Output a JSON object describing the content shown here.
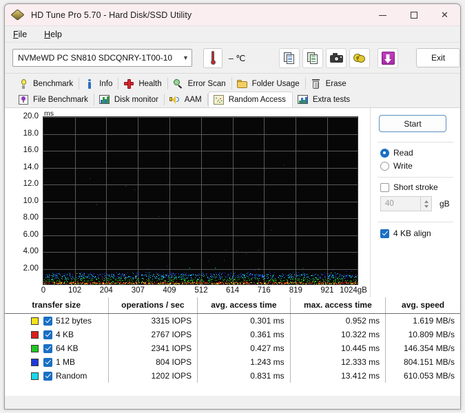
{
  "window": {
    "title": "HD Tune Pro 5.70 - Hard Disk/SSD Utility",
    "app_icon": "diamond-icon",
    "minimize_label": "—",
    "maximize_label": "□",
    "close_label": "✕"
  },
  "menu": {
    "items": [
      {
        "label": "File",
        "mnemonic": "F"
      },
      {
        "label": "Help",
        "mnemonic": "H"
      }
    ]
  },
  "toolbar": {
    "drive": "NVMeWD PC SN810 SDCQNRY-1T00-10",
    "drive_chevron": "▼",
    "temperature": "– ℃",
    "thermometer_icon": "thermometer-icon",
    "buttons": [
      {
        "name": "copy-to-clipboard-button",
        "icon": "copy-document-icon"
      },
      {
        "name": "export-button",
        "icon": "export-document-icon"
      },
      {
        "name": "screenshot-button",
        "icon": "camera-icon"
      },
      {
        "name": "measure-button",
        "icon": "tape-measure-icon"
      },
      {
        "name": "download-button",
        "icon": "download-arrow-icon"
      }
    ],
    "exit_label": "Exit"
  },
  "tabs": {
    "row1": [
      {
        "label": "Benchmark",
        "icon": "lightbulb-icon",
        "active": false
      },
      {
        "label": "Info",
        "icon": "info-icon",
        "active": false
      },
      {
        "label": "Health",
        "icon": "red-cross-icon",
        "active": false
      },
      {
        "label": "Error Scan",
        "icon": "magnifier-icon",
        "active": false
      },
      {
        "label": "Folder Usage",
        "icon": "folder-icon",
        "active": false
      },
      {
        "label": "Erase",
        "icon": "trash-icon",
        "active": false
      }
    ],
    "row2": [
      {
        "label": "File Benchmark",
        "icon": "file-benchmark-icon",
        "active": false
      },
      {
        "label": "Disk monitor",
        "icon": "bar-chart-icon",
        "active": false
      },
      {
        "label": "AAM",
        "icon": "speaker-icon",
        "active": false
      },
      {
        "label": "Random Access",
        "icon": "scatter-plot-icon",
        "active": true
      },
      {
        "label": "Extra tests",
        "icon": "extra-tests-icon",
        "active": false
      }
    ]
  },
  "panel": {
    "start_label": "Start",
    "read_label": "Read",
    "write_label": "Write",
    "read_selected": true,
    "write_selected": false,
    "short_stroke_label": "Short stroke",
    "short_stroke_checked": false,
    "short_stroke_value": "40",
    "short_stroke_unit": "gB",
    "align_label": "4 KB align",
    "align_checked": true
  },
  "chart_data": {
    "type": "scatter",
    "title": "",
    "xlabel": "",
    "ylabel": "ms",
    "yunit": "ms",
    "xunit": "gB",
    "ylim": [
      0,
      20
    ],
    "xlim": [
      0,
      1024
    ],
    "grid": true,
    "background": "#070707",
    "gridline_color": "#5a5a5a",
    "ytick_labels": [
      "20.0",
      "18.0",
      "16.0",
      "14.0",
      "12.0",
      "10.0",
      "8.00",
      "6.00",
      "4.00",
      "2.00"
    ],
    "ytick_values": [
      20,
      18,
      16,
      14,
      12,
      10,
      8,
      6,
      4,
      2
    ],
    "xtick_labels": [
      "0",
      "102",
      "204",
      "307",
      "409",
      "512",
      "614",
      "716",
      "819",
      "921",
      "1024gB"
    ],
    "xtick_values": [
      0,
      102,
      204,
      307,
      409,
      512,
      614,
      716,
      819,
      921,
      1024
    ],
    "series": [
      {
        "name": "512 bytes",
        "color": "#f2e21a",
        "access_time_range_ms": [
          0.18,
          0.45
        ],
        "point_count": 420
      },
      {
        "name": "4 KB",
        "color": "#d81f1f",
        "access_time_range_ms": [
          0.22,
          0.55
        ],
        "point_count": 420
      },
      {
        "name": "64 KB",
        "color": "#22c522",
        "access_time_range_ms": [
          0.35,
          0.95
        ],
        "point_count": 420
      },
      {
        "name": "1 MB",
        "color": "#2038d8",
        "access_time_range_ms": [
          0.85,
          1.7
        ],
        "point_count": 420
      },
      {
        "name": "Random",
        "color": "#1ad8e8",
        "access_time_range_ms": [
          0.7,
          1.55
        ],
        "point_count": 420
      }
    ]
  },
  "results": {
    "columns": [
      "transfer size",
      "operations / sec",
      "avg. access time",
      "max. access time",
      "avg. speed"
    ],
    "rows": [
      {
        "color": "#f2e21a",
        "checked": true,
        "transfer_size": "512 bytes",
        "operations_per_sec": "3315 IOPS",
        "avg_access_time": "0.301 ms",
        "max_access_time": "0.952 ms",
        "avg_speed": "1.619 MB/s"
      },
      {
        "color": "#d81f1f",
        "checked": true,
        "transfer_size": "4 KB",
        "operations_per_sec": "2767 IOPS",
        "avg_access_time": "0.361 ms",
        "max_access_time": "10.322 ms",
        "avg_speed": "10.809 MB/s"
      },
      {
        "color": "#22c522",
        "checked": true,
        "transfer_size": "64 KB",
        "operations_per_sec": "2341 IOPS",
        "avg_access_time": "0.427 ms",
        "max_access_time": "10.445 ms",
        "avg_speed": "146.354 MB/s"
      },
      {
        "color": "#2038d8",
        "checked": true,
        "transfer_size": "1 MB",
        "operations_per_sec": "804 IOPS",
        "avg_access_time": "1.243 ms",
        "max_access_time": "12.333 ms",
        "avg_speed": "804.151 MB/s"
      },
      {
        "color": "#1ad8e8",
        "checked": true,
        "transfer_size": "Random",
        "operations_per_sec": "1202 IOPS",
        "avg_access_time": "0.831 ms",
        "max_access_time": "13.412 ms",
        "avg_speed": "610.053 MB/s"
      }
    ]
  }
}
